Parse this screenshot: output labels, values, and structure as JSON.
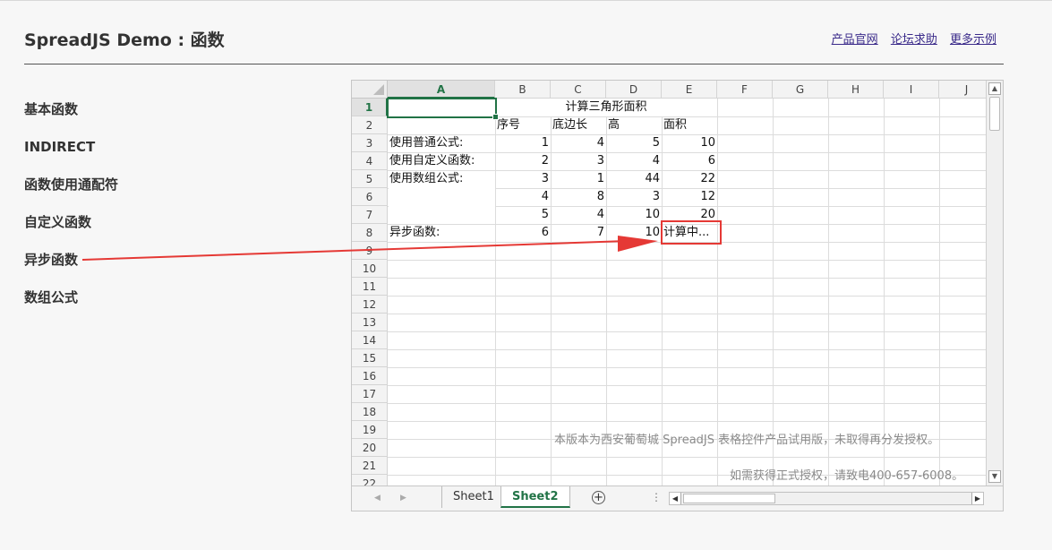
{
  "header": {
    "title": "SpreadJS Demo : 函数",
    "links": [
      "产品官网",
      "论坛求助",
      "更多示例"
    ]
  },
  "nav": {
    "items": [
      "基本函数",
      "INDIRECT",
      "函数使用通配符",
      "自定义函数",
      "异步函数",
      "数组公式"
    ]
  },
  "sheet": {
    "columns": [
      "A",
      "B",
      "C",
      "D",
      "E",
      "F",
      "G",
      "H",
      "I",
      "J"
    ],
    "rows": [
      "1",
      "2",
      "3",
      "4",
      "5",
      "6",
      "7",
      "8",
      "9",
      "10",
      "11",
      "12",
      "13",
      "14",
      "15",
      "16",
      "17",
      "18",
      "19",
      "20",
      "21",
      "22"
    ],
    "selected_cell": "A1",
    "cells": {
      "title": "计算三角形面积",
      "b2": "序号",
      "c2": "底边长",
      "d2": "高",
      "e2": "面积",
      "a3": "使用普通公式:",
      "b3": "1",
      "c3": "4",
      "d3": "5",
      "e3": "10",
      "a4": "使用自定义函数:",
      "b4": "2",
      "c4": "3",
      "d4": "4",
      "e4": "6",
      "a5": "使用数组公式:",
      "b5": "3",
      "c5": "1",
      "d5": "44",
      "e5": "22",
      "b6": "4",
      "c6": "8",
      "d6": "3",
      "e6": "12",
      "b7": "5",
      "c7": "4",
      "d7": "10",
      "e7": "20",
      "a8": "异步函数:",
      "b8": "6",
      "c8": "7",
      "d8": "10",
      "e8": "计算中..."
    },
    "watermark": [
      "本版本为西安葡萄城 SpreadJS 表格控件产品试用版，未取得再分发授权。",
      "如需获得正式授权，请致电400-657-6008。"
    ],
    "tabs": [
      "Sheet1",
      "Sheet2"
    ],
    "active_tab": "Sheet2",
    "add_sheet_icon": "plus-circle-icon",
    "accent_color": "#217346",
    "annotation_color": "#e53935"
  }
}
